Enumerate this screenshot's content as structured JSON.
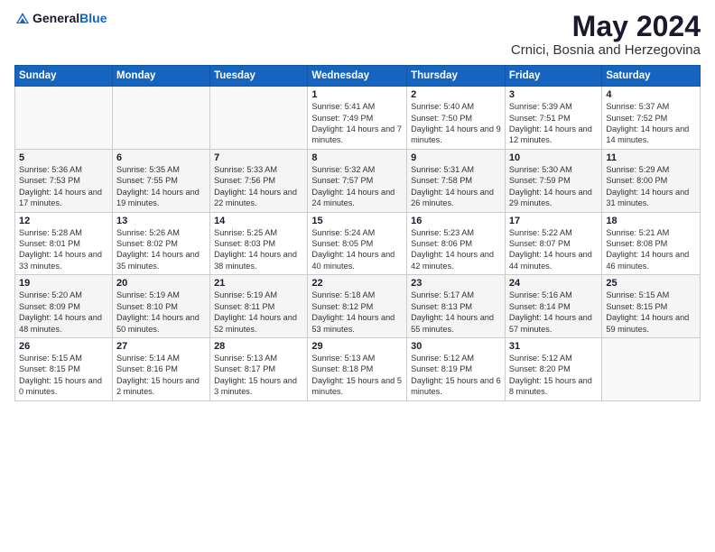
{
  "header": {
    "logo_general": "General",
    "logo_blue": "Blue",
    "month_title": "May 2024",
    "location": "Crnici, Bosnia and Herzegovina"
  },
  "days_of_week": [
    "Sunday",
    "Monday",
    "Tuesday",
    "Wednesday",
    "Thursday",
    "Friday",
    "Saturday"
  ],
  "weeks": [
    [
      {
        "day": "",
        "info": ""
      },
      {
        "day": "",
        "info": ""
      },
      {
        "day": "",
        "info": ""
      },
      {
        "day": "1",
        "info": "Sunrise: 5:41 AM\nSunset: 7:49 PM\nDaylight: 14 hours\nand 7 minutes."
      },
      {
        "day": "2",
        "info": "Sunrise: 5:40 AM\nSunset: 7:50 PM\nDaylight: 14 hours\nand 9 minutes."
      },
      {
        "day": "3",
        "info": "Sunrise: 5:39 AM\nSunset: 7:51 PM\nDaylight: 14 hours\nand 12 minutes."
      },
      {
        "day": "4",
        "info": "Sunrise: 5:37 AM\nSunset: 7:52 PM\nDaylight: 14 hours\nand 14 minutes."
      }
    ],
    [
      {
        "day": "5",
        "info": "Sunrise: 5:36 AM\nSunset: 7:53 PM\nDaylight: 14 hours\nand 17 minutes."
      },
      {
        "day": "6",
        "info": "Sunrise: 5:35 AM\nSunset: 7:55 PM\nDaylight: 14 hours\nand 19 minutes."
      },
      {
        "day": "7",
        "info": "Sunrise: 5:33 AM\nSunset: 7:56 PM\nDaylight: 14 hours\nand 22 minutes."
      },
      {
        "day": "8",
        "info": "Sunrise: 5:32 AM\nSunset: 7:57 PM\nDaylight: 14 hours\nand 24 minutes."
      },
      {
        "day": "9",
        "info": "Sunrise: 5:31 AM\nSunset: 7:58 PM\nDaylight: 14 hours\nand 26 minutes."
      },
      {
        "day": "10",
        "info": "Sunrise: 5:30 AM\nSunset: 7:59 PM\nDaylight: 14 hours\nand 29 minutes."
      },
      {
        "day": "11",
        "info": "Sunrise: 5:29 AM\nSunset: 8:00 PM\nDaylight: 14 hours\nand 31 minutes."
      }
    ],
    [
      {
        "day": "12",
        "info": "Sunrise: 5:28 AM\nSunset: 8:01 PM\nDaylight: 14 hours\nand 33 minutes."
      },
      {
        "day": "13",
        "info": "Sunrise: 5:26 AM\nSunset: 8:02 PM\nDaylight: 14 hours\nand 35 minutes."
      },
      {
        "day": "14",
        "info": "Sunrise: 5:25 AM\nSunset: 8:03 PM\nDaylight: 14 hours\nand 38 minutes."
      },
      {
        "day": "15",
        "info": "Sunrise: 5:24 AM\nSunset: 8:05 PM\nDaylight: 14 hours\nand 40 minutes."
      },
      {
        "day": "16",
        "info": "Sunrise: 5:23 AM\nSunset: 8:06 PM\nDaylight: 14 hours\nand 42 minutes."
      },
      {
        "day": "17",
        "info": "Sunrise: 5:22 AM\nSunset: 8:07 PM\nDaylight: 14 hours\nand 44 minutes."
      },
      {
        "day": "18",
        "info": "Sunrise: 5:21 AM\nSunset: 8:08 PM\nDaylight: 14 hours\nand 46 minutes."
      }
    ],
    [
      {
        "day": "19",
        "info": "Sunrise: 5:20 AM\nSunset: 8:09 PM\nDaylight: 14 hours\nand 48 minutes."
      },
      {
        "day": "20",
        "info": "Sunrise: 5:19 AM\nSunset: 8:10 PM\nDaylight: 14 hours\nand 50 minutes."
      },
      {
        "day": "21",
        "info": "Sunrise: 5:19 AM\nSunset: 8:11 PM\nDaylight: 14 hours\nand 52 minutes."
      },
      {
        "day": "22",
        "info": "Sunrise: 5:18 AM\nSunset: 8:12 PM\nDaylight: 14 hours\nand 53 minutes."
      },
      {
        "day": "23",
        "info": "Sunrise: 5:17 AM\nSunset: 8:13 PM\nDaylight: 14 hours\nand 55 minutes."
      },
      {
        "day": "24",
        "info": "Sunrise: 5:16 AM\nSunset: 8:14 PM\nDaylight: 14 hours\nand 57 minutes."
      },
      {
        "day": "25",
        "info": "Sunrise: 5:15 AM\nSunset: 8:15 PM\nDaylight: 14 hours\nand 59 minutes."
      }
    ],
    [
      {
        "day": "26",
        "info": "Sunrise: 5:15 AM\nSunset: 8:15 PM\nDaylight: 15 hours\nand 0 minutes."
      },
      {
        "day": "27",
        "info": "Sunrise: 5:14 AM\nSunset: 8:16 PM\nDaylight: 15 hours\nand 2 minutes."
      },
      {
        "day": "28",
        "info": "Sunrise: 5:13 AM\nSunset: 8:17 PM\nDaylight: 15 hours\nand 3 minutes."
      },
      {
        "day": "29",
        "info": "Sunrise: 5:13 AM\nSunset: 8:18 PM\nDaylight: 15 hours\nand 5 minutes."
      },
      {
        "day": "30",
        "info": "Sunrise: 5:12 AM\nSunset: 8:19 PM\nDaylight: 15 hours\nand 6 minutes."
      },
      {
        "day": "31",
        "info": "Sunrise: 5:12 AM\nSunset: 8:20 PM\nDaylight: 15 hours\nand 8 minutes."
      },
      {
        "day": "",
        "info": ""
      }
    ]
  ]
}
